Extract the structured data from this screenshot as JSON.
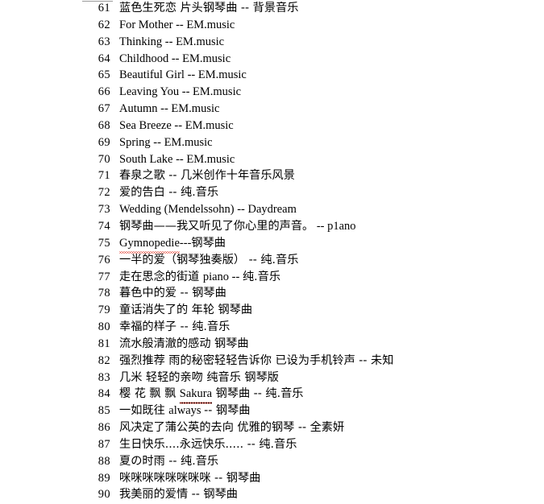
{
  "document": {
    "type": "numbered-track-list",
    "background_color": "#ffffff",
    "text_color": "#000000",
    "spellcheck_underline_color": "#e03020",
    "top_rule_color": "#9a9a9a",
    "first_number": 61,
    "last_number": 90,
    "row_count": 30,
    "rows": [
      {
        "num": "61",
        "segments": [
          {
            "text": "蓝色生死恋 片头钢琴曲 -- 背景音乐",
            "script": "cjk"
          }
        ]
      },
      {
        "num": "62",
        "segments": [
          {
            "text": "For Mother -- EM.music",
            "script": "lat"
          }
        ]
      },
      {
        "num": "63",
        "segments": [
          {
            "text": "Thinking -- EM.music",
            "script": "lat"
          }
        ]
      },
      {
        "num": "64",
        "segments": [
          {
            "text": "Childhood -- EM.music",
            "script": "lat"
          }
        ]
      },
      {
        "num": "65",
        "segments": [
          {
            "text": "Beautiful Girl -- EM.music",
            "script": "lat"
          }
        ]
      },
      {
        "num": "66",
        "segments": [
          {
            "text": "Leaving You -- EM.music",
            "script": "lat"
          }
        ]
      },
      {
        "num": "67",
        "segments": [
          {
            "text": "Autumn -- EM.music",
            "script": "lat"
          }
        ]
      },
      {
        "num": "68",
        "segments": [
          {
            "text": "Sea Breeze -- EM.music",
            "script": "lat"
          }
        ]
      },
      {
        "num": "69",
        "segments": [
          {
            "text": "Spring -- EM.music",
            "script": "lat"
          }
        ]
      },
      {
        "num": "70",
        "segments": [
          {
            "text": "South Lake -- EM.music",
            "script": "lat"
          }
        ]
      },
      {
        "num": "71",
        "segments": [
          {
            "text": "春泉之歌 -- 几米创作十年音乐风景",
            "script": "cjk"
          }
        ]
      },
      {
        "num": "72",
        "segments": [
          {
            "text": "爱的告白 -- 纯.音乐",
            "script": "cjk"
          }
        ]
      },
      {
        "num": "73",
        "segments": [
          {
            "text": "Wedding (Mendelssohn) -- Daydream",
            "script": "lat"
          }
        ]
      },
      {
        "num": "74",
        "segments": [
          {
            "text": "钢琴曲——我又听见了你心里的声音。",
            "script": "cjk"
          },
          {
            "text": " -- p1ano",
            "script": "lat"
          }
        ]
      },
      {
        "num": "75",
        "segments": [
          {
            "text": "Gymnopedie",
            "script": "lat",
            "spellcheck": true
          },
          {
            "text": "---",
            "script": "lat"
          },
          {
            "text": "钢琴曲",
            "script": "cjk"
          }
        ]
      },
      {
        "num": "76",
        "segments": [
          {
            "text": "一半的爱（钢琴独奏版） -- 纯.音乐",
            "script": "cjk"
          }
        ]
      },
      {
        "num": "77",
        "segments": [
          {
            "text": "走在思念的街道 ",
            "script": "cjk"
          },
          {
            "text": "piano -- ",
            "script": "lat"
          },
          {
            "text": "纯.音乐",
            "script": "cjk"
          }
        ]
      },
      {
        "num": "78",
        "segments": [
          {
            "text": "暮色中的爱 -- 钢琴曲",
            "script": "cjk"
          }
        ]
      },
      {
        "num": "79",
        "segments": [
          {
            "text": "童话消失了的 年轮 钢琴曲",
            "script": "cjk"
          }
        ]
      },
      {
        "num": "80",
        "segments": [
          {
            "text": "幸福的样子 -- 纯.音乐",
            "script": "cjk"
          }
        ]
      },
      {
        "num": "81",
        "segments": [
          {
            "text": "流水般清澈的感动 钢琴曲",
            "script": "cjk"
          }
        ]
      },
      {
        "num": "82",
        "segments": [
          {
            "text": "强烈推荐 雨的秘密轻轻告诉你 已设为手机铃声 -- 未知",
            "script": "cjk"
          }
        ]
      },
      {
        "num": "83",
        "segments": [
          {
            "text": "几米 轻轻的亲吻 纯音乐 钢琴版",
            "script": "cjk"
          }
        ]
      },
      {
        "num": "84",
        "segments": [
          {
            "text": "樱 花 飘 飘 ",
            "script": "cjk"
          },
          {
            "text": "Sakura",
            "script": "lat",
            "spellcheck": true,
            "underline": true
          },
          {
            "text": " 钢琴曲 -- 纯.音乐",
            "script": "cjk"
          }
        ]
      },
      {
        "num": "85",
        "segments": [
          {
            "text": "一如既往 ",
            "script": "cjk"
          },
          {
            "text": "always ",
            "script": "lat"
          },
          {
            "text": "-- 钢琴曲",
            "script": "cjk"
          }
        ]
      },
      {
        "num": "86",
        "segments": [
          {
            "text": "风决定了蒲公英的去向 优雅的钢琴 -- 全素妍",
            "script": "cjk"
          }
        ]
      },
      {
        "num": "87",
        "segments": [
          {
            "text": "生日快乐....永远快乐..... -- 纯.音乐",
            "script": "cjk"
          }
        ]
      },
      {
        "num": "88",
        "segments": [
          {
            "text": "夏の时雨 -- 纯.音乐",
            "script": "cjk"
          }
        ]
      },
      {
        "num": "89",
        "segments": [
          {
            "text": "咪咪咪咪咪咪咪咪 -- 钢琴曲",
            "script": "cjk"
          }
        ]
      },
      {
        "num": "90",
        "segments": [
          {
            "text": "我美丽的爱情 -- 钢琴曲",
            "script": "cjk"
          }
        ]
      }
    ]
  }
}
